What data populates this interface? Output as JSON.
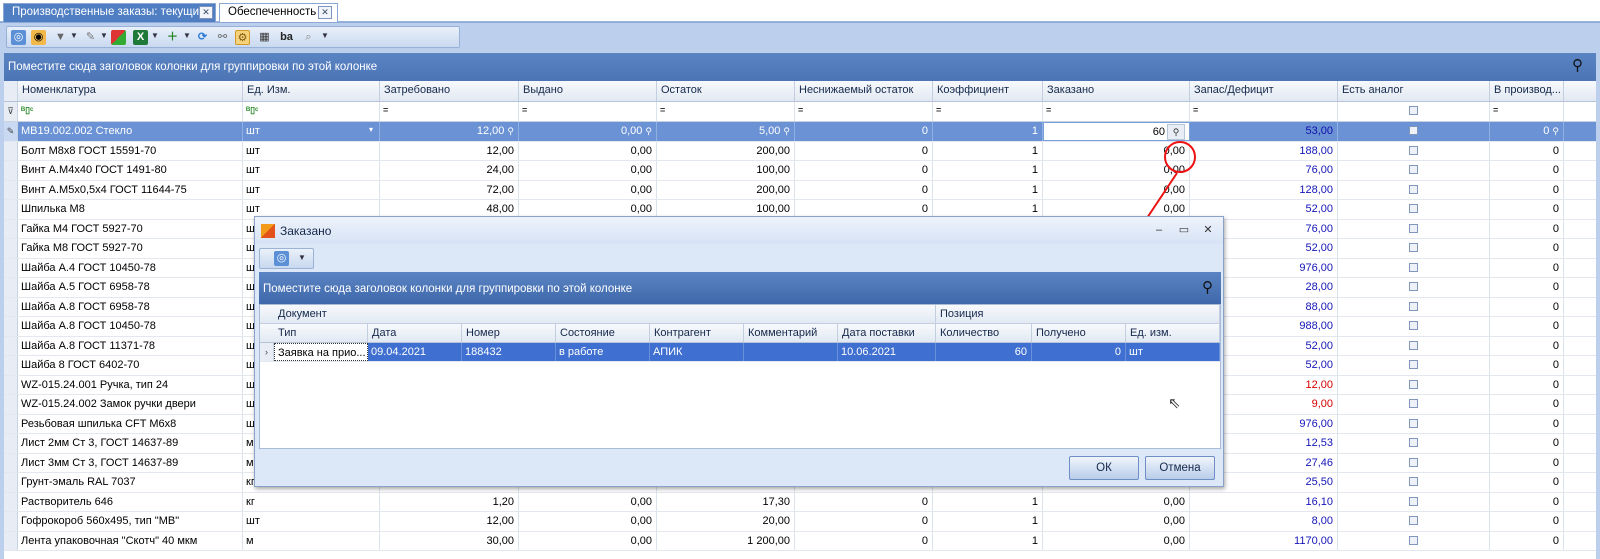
{
  "tabs": [
    {
      "label": "Производственные заказы: текущие",
      "close": "✕"
    },
    {
      "label": "Обеспеченность",
      "close": "✕"
    }
  ],
  "group_panel_text": "Поместите сюда заголовок колонки для группировки по этой колонке",
  "columns": [
    "Номенклатура",
    "Ед. Изм.",
    "Затребовано",
    "Выдано",
    "Остаток",
    "Неснижаемый остаток",
    "Коэффициент",
    "Заказано",
    "Запас/Дефицит",
    "Есть аналог",
    "В производ..."
  ],
  "filter_row": {
    "text_filter_glyph": "ᴮ▯ᶜ",
    "eq_glyph": "="
  },
  "rows": [
    {
      "name": "МВ19.002.002 Стекло",
      "unit": "шт",
      "req": "12,00",
      "iss": "0,00",
      "rest": "5,00",
      "min": "0",
      "coef": "1",
      "ord": "60",
      "stock": "53,00",
      "prod": "0",
      "deficit": false,
      "selected": true
    },
    {
      "name": "Болт М8х8 ГОСТ 15591-70",
      "unit": "шт",
      "req": "12,00",
      "iss": "0,00",
      "rest": "200,00",
      "min": "0",
      "coef": "1",
      "ord": "0,00",
      "stock": "188,00",
      "prod": "0",
      "deficit": false
    },
    {
      "name": "Винт А.М4х40 ГОСТ 1491-80",
      "unit": "шт",
      "req": "24,00",
      "iss": "0,00",
      "rest": "100,00",
      "min": "0",
      "coef": "1",
      "ord": "0,00",
      "stock": "76,00",
      "prod": "0",
      "deficit": false
    },
    {
      "name": "Винт А.М5х0,5х4 ГОСТ 11644-75",
      "unit": "шт",
      "req": "72,00",
      "iss": "0,00",
      "rest": "200,00",
      "min": "0",
      "coef": "1",
      "ord": "0,00",
      "stock": "128,00",
      "prod": "0",
      "deficit": false
    },
    {
      "name": "Шпилька М8",
      "unit": "шт",
      "req": "48,00",
      "iss": "0,00",
      "rest": "100,00",
      "min": "0",
      "coef": "1",
      "ord": "0,00",
      "stock": "52,00",
      "prod": "0",
      "deficit": false
    },
    {
      "name": "Гайка М4 ГОСТ 5927-70",
      "unit": "ш",
      "req": "",
      "iss": "",
      "rest": "",
      "min": "",
      "coef": "",
      "ord": "",
      "stock": "76,00",
      "prod": "0",
      "deficit": false
    },
    {
      "name": "Гайка М8 ГОСТ 5927-70",
      "unit": "ш",
      "req": "",
      "iss": "",
      "rest": "",
      "min": "",
      "coef": "",
      "ord": "",
      "stock": "52,00",
      "prod": "0",
      "deficit": false
    },
    {
      "name": "Шайба А.4 ГОСТ 10450-78",
      "unit": "ш",
      "req": "",
      "iss": "",
      "rest": "",
      "min": "",
      "coef": "",
      "ord": "",
      "stock": "976,00",
      "prod": "0",
      "deficit": false
    },
    {
      "name": "Шайба А.5 ГОСТ  6958-78",
      "unit": "ш",
      "req": "",
      "iss": "",
      "rest": "",
      "min": "",
      "coef": "",
      "ord": "",
      "stock": "28,00",
      "prod": "0",
      "deficit": false
    },
    {
      "name": "Шайба А.8 ГОСТ 6958-78",
      "unit": "ш",
      "req": "",
      "iss": "",
      "rest": "",
      "min": "",
      "coef": "",
      "ord": "",
      "stock": "88,00",
      "prod": "0",
      "deficit": false
    },
    {
      "name": "Шайба А.8 ГОСТ 10450-78",
      "unit": "ш",
      "req": "",
      "iss": "",
      "rest": "",
      "min": "",
      "coef": "",
      "ord": "",
      "stock": "988,00",
      "prod": "0",
      "deficit": false
    },
    {
      "name": "Шайба А.8 ГОСТ 11371-78",
      "unit": "ш",
      "req": "",
      "iss": "",
      "rest": "",
      "min": "",
      "coef": "",
      "ord": "",
      "stock": "52,00",
      "prod": "0",
      "deficit": false
    },
    {
      "name": "Шайба 8 ГОСТ 6402-70",
      "unit": "ш",
      "req": "",
      "iss": "",
      "rest": "",
      "min": "",
      "coef": "",
      "ord": "",
      "stock": "52,00",
      "prod": "0",
      "deficit": false
    },
    {
      "name": "WZ-015.24.001 Ручка, тип 24",
      "unit": "ш",
      "req": "",
      "iss": "",
      "rest": "",
      "min": "",
      "coef": "",
      "ord": "",
      "stock": "12,00",
      "prod": "0",
      "deficit": true
    },
    {
      "name": "WZ-015.24.002 Замок ручки двери",
      "unit": "ш",
      "req": "",
      "iss": "",
      "rest": "",
      "min": "",
      "coef": "",
      "ord": "",
      "stock": "9,00",
      "prod": "0",
      "deficit": true
    },
    {
      "name": "Резьбовая шпилька CFT M6x8",
      "unit": "ш",
      "req": "",
      "iss": "",
      "rest": "",
      "min": "",
      "coef": "",
      "ord": "",
      "stock": "976,00",
      "prod": "0",
      "deficit": false
    },
    {
      "name": "Лист 2мм Ст 3, ГОСТ 14637-89",
      "unit": "м",
      "req": "",
      "iss": "",
      "rest": "",
      "min": "",
      "coef": "",
      "ord": "",
      "stock": "12,53",
      "prod": "0",
      "deficit": false
    },
    {
      "name": "Лист 3мм Ст 3, ГОСТ 14637-89",
      "unit": "м",
      "req": "",
      "iss": "",
      "rest": "",
      "min": "",
      "coef": "",
      "ord": "",
      "stock": "27,46",
      "prod": "0",
      "deficit": false
    },
    {
      "name": "Грунт-эмаль RAL 7037",
      "unit": "кг",
      "req": "",
      "iss": "",
      "rest": "",
      "min": "",
      "coef": "",
      "ord": "",
      "stock": "25,50",
      "prod": "0",
      "deficit": false
    },
    {
      "name": "Растворитель 646",
      "unit": "кг",
      "req": "1,20",
      "iss": "0,00",
      "rest": "17,30",
      "min": "0",
      "coef": "1",
      "ord": "0,00",
      "stock": "16,10",
      "prod": "0",
      "deficit": false
    },
    {
      "name": "Гофрокороб 560х495, тип \"МВ\"",
      "unit": "шт",
      "req": "12,00",
      "iss": "0,00",
      "rest": "20,00",
      "min": "0",
      "coef": "1",
      "ord": "0,00",
      "stock": "8,00",
      "prod": "0",
      "deficit": false
    },
    {
      "name": "Лента упаковочная \"Скотч\" 40 мкм",
      "unit": "м",
      "req": "30,00",
      "iss": "0,00",
      "rest": "1 200,00",
      "min": "0",
      "coef": "1",
      "ord": "0,00",
      "stock": "1170,00",
      "prod": "0",
      "deficit": false
    }
  ],
  "dialog": {
    "title": "Заказано",
    "window_buttons": {
      "minimize": "–",
      "maximize": "▭",
      "close": "✕"
    },
    "group_panel_text": "Поместите сюда заголовок колонки для группировки по этой колонке",
    "bands": [
      "Документ",
      "Позиция"
    ],
    "columns": [
      "Тип",
      "Дата",
      "Номер",
      "Состояние",
      "Контрагент",
      "Комментарий",
      "Дата поставки",
      "Количество",
      "Получено",
      "Ед. изм."
    ],
    "rows": [
      {
        "type": "Заявка на прио...",
        "date": "09.04.2021",
        "number": "188432",
        "state": "в работе",
        "contractor": "АПИК",
        "comment": "",
        "delivery": "10.06.2021",
        "qty": "60",
        "received": "0",
        "unit": "шт"
      }
    ],
    "ok_label": "ОК",
    "cancel_label": "Отмена"
  },
  "colors": {
    "accent": "#4f7ec3",
    "selected_row": "#6b92d4",
    "stock_positive": "#1515b8",
    "stock_deficit": "#d40000",
    "callout": "#e11111"
  }
}
